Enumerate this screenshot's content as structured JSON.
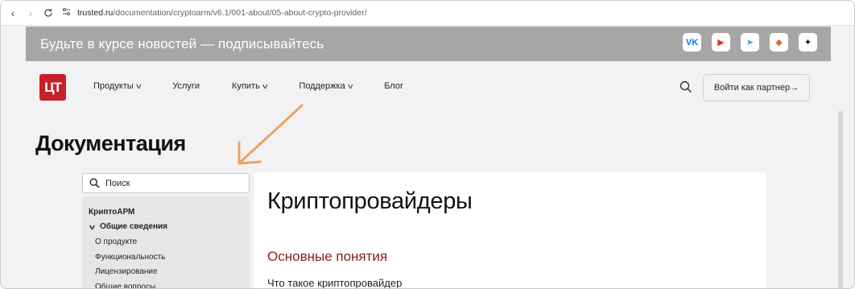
{
  "browser": {
    "url_host": "trusted.ru",
    "url_path": "/documentation/cryptoarm/v6.1/001-about/05-about-crypto-provider/"
  },
  "banner": {
    "text": "Будьте в курсе новостей — подписывайтесь",
    "socials": [
      {
        "name": "vk",
        "glyph": "VK",
        "color": "#0077ff"
      },
      {
        "name": "video",
        "glyph": "▶",
        "color": "#e0352b"
      },
      {
        "name": "telegram",
        "glyph": "➤",
        "color": "#2aa3e0"
      },
      {
        "name": "gitlab",
        "glyph": "◆",
        "color": "#e8652b"
      },
      {
        "name": "sparkle",
        "glyph": "✦",
        "color": "#111111"
      }
    ]
  },
  "header": {
    "logo_text": "ЦТ",
    "nav": [
      {
        "label": "Продукты",
        "has_dropdown": true
      },
      {
        "label": "Услуги",
        "has_dropdown": false
      },
      {
        "label": "Купить",
        "has_dropdown": true
      },
      {
        "label": "Поддержка",
        "has_dropdown": true
      },
      {
        "label": "Блог",
        "has_dropdown": false
      }
    ],
    "partner_button": "Войти как партнер→"
  },
  "page": {
    "title": "Документация"
  },
  "sidebar": {
    "search_placeholder": "Поиск",
    "section": "КриптоАРМ",
    "group": "Общие сведения",
    "items": [
      "О продукте",
      "Функциональность",
      "Лицензирование",
      "Общие вопросы"
    ]
  },
  "content": {
    "title": "Криптопровайдеры",
    "subtitle": "Основные понятия",
    "question": "Что такое криптопровайдер"
  },
  "colors": {
    "banner_bg": "#a6a6a6",
    "logo_red": "#c8202a",
    "subtitle_red": "#8a1c1c",
    "arrow_orange": "#f0a060"
  }
}
